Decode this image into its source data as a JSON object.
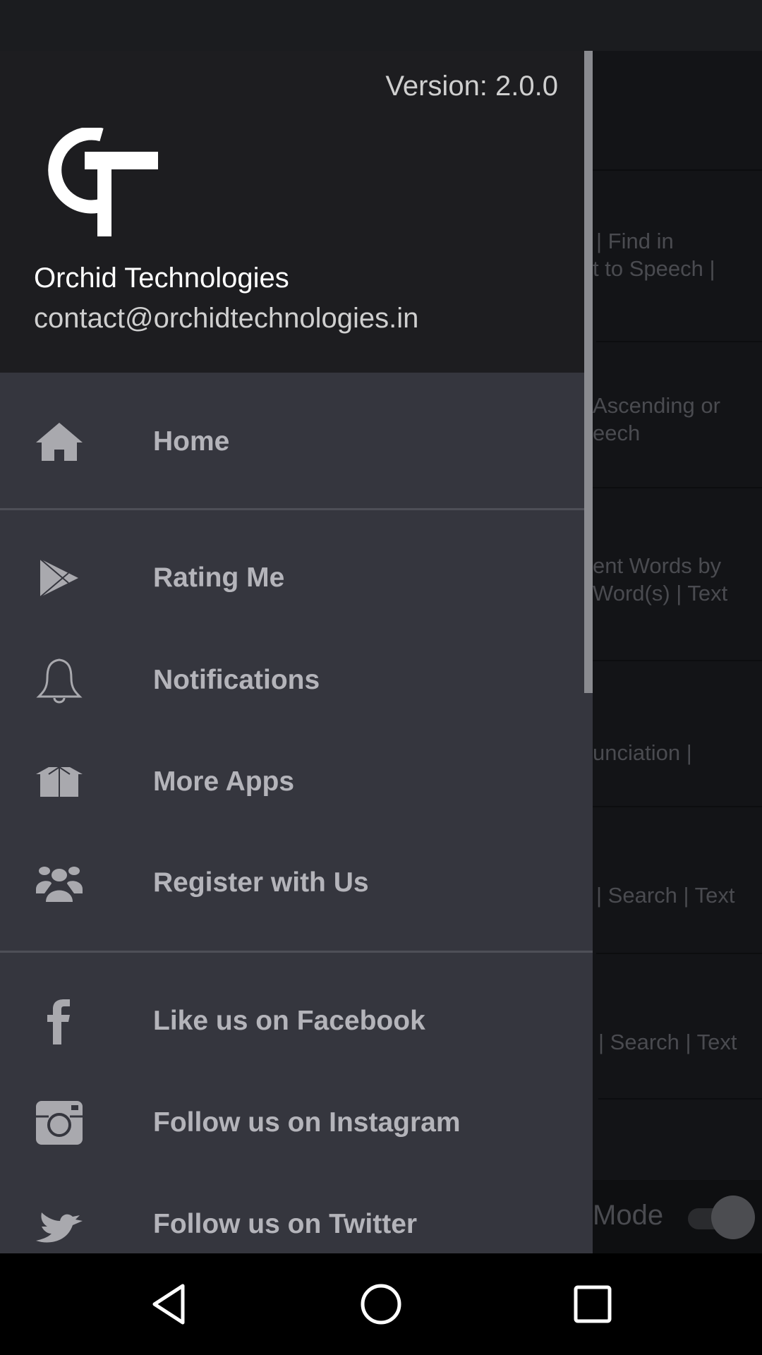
{
  "drawer": {
    "version": "Version: 2.0.0",
    "logo_text": "OT",
    "org_name": "Orchid Technologies",
    "email": "contact@orchidtechnologies.in",
    "items": [
      {
        "label": "Home",
        "icon": "home-icon"
      },
      {
        "label": "Rating Me",
        "icon": "play-store-icon"
      },
      {
        "label": "Notifications",
        "icon": "bell-icon"
      },
      {
        "label": "More Apps",
        "icon": "box-icon"
      },
      {
        "label": "Register with Us",
        "icon": "users-icon"
      },
      {
        "label": "Like us on Facebook",
        "icon": "facebook-icon"
      },
      {
        "label": "Follow us on Instagram",
        "icon": "instagram-icon"
      },
      {
        "label": "Follow us on Twitter",
        "icon": "twitter-icon"
      }
    ]
  },
  "background": {
    "rows": [
      {
        "line1": "| Find in",
        "line2": "t to Speech |"
      },
      {
        "line1": "Ascending or",
        "line2": "eech"
      },
      {
        "line1": "ent Words by",
        "line2": "Word(s) | Text"
      },
      {
        "line1": "unciation |",
        "line2": ""
      },
      {
        "line1": "| Search | Text",
        "line2": ""
      },
      {
        "line1": "| Search | Text",
        "line2": ""
      }
    ],
    "mode_label": "Mode",
    "mode_toggle_on": true
  },
  "colors": {
    "drawer_bg": "#35363e",
    "header_bg": "#1d1d20",
    "label": "#b4b4ba"
  }
}
